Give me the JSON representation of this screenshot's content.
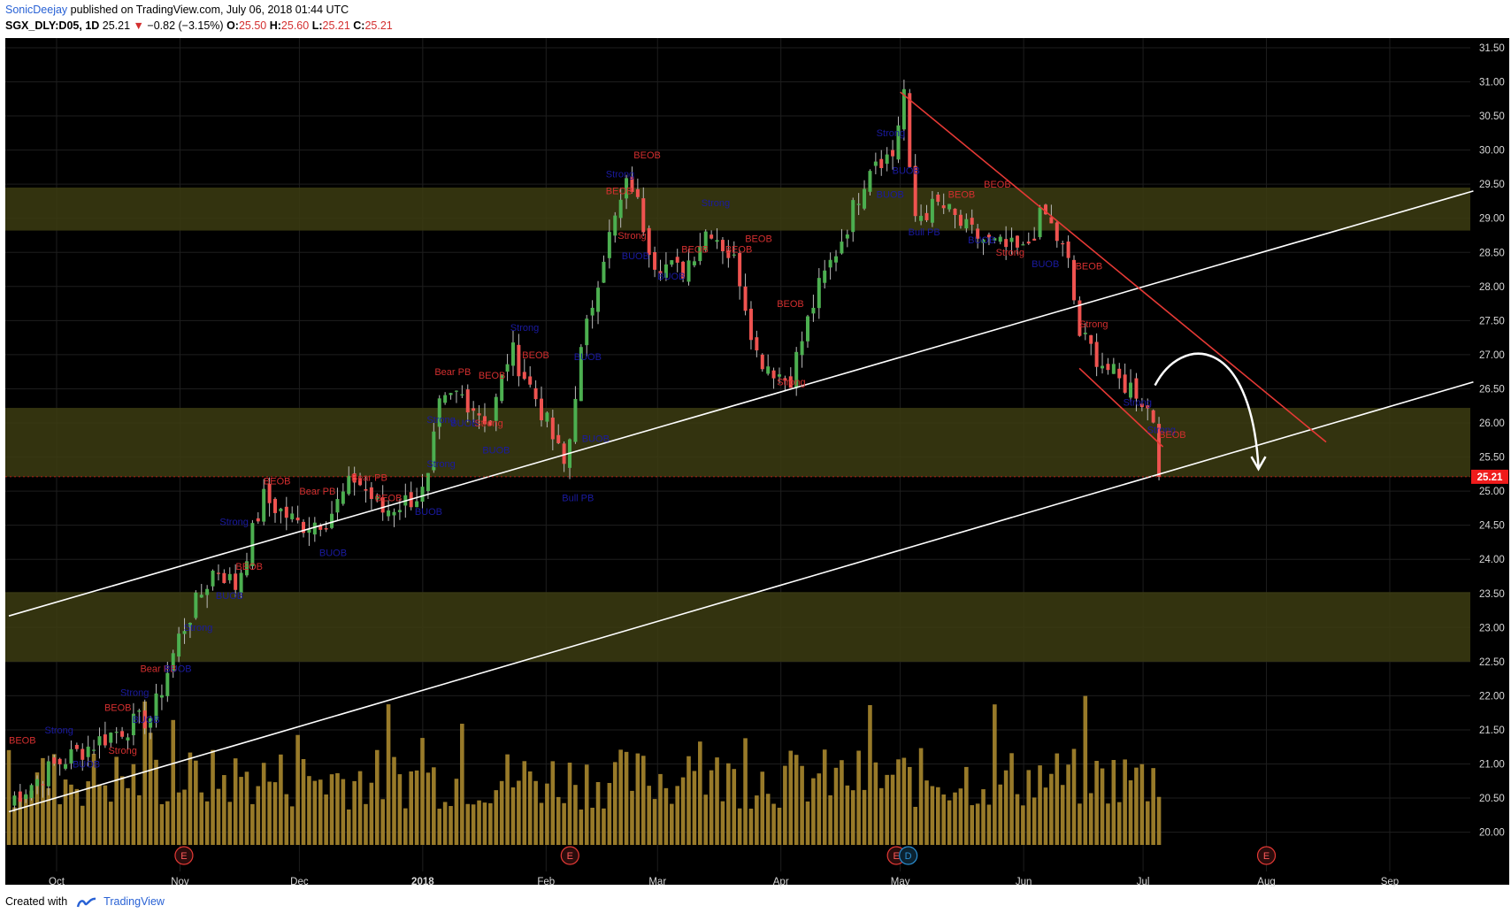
{
  "header": {
    "author": "SonicDeejay",
    "published_text": " published on TradingView.com, July 06, 2018 01:44 UTC",
    "symbol": "SGX_DLY:D05, 1D",
    "last": "25.21",
    "change": "−0.82 (−3.15%)",
    "o_label": "O:",
    "o": "25.50",
    "h_label": "H:",
    "h": "25.60",
    "l_label": "L:",
    "l": "25.21",
    "c_label": "C:",
    "c": "25.21"
  },
  "footer": {
    "created_with": "Created with",
    "brand": "TradingView"
  },
  "colors": {
    "background": "#000000",
    "up": "#4caf50",
    "down": "#ef5350",
    "zone": "#3c3c12",
    "volume": "#a8872e",
    "trendline": "#ffffff",
    "channel": "#e53935",
    "price_tag": "#ef1b1b"
  },
  "chart_data": {
    "type": "candlestick",
    "ylim": [
      19.75,
      31.95
    ],
    "y_ticks": [
      "20.00",
      "20.50",
      "21.00",
      "21.50",
      "22.00",
      "22.50",
      "23.00",
      "23.50",
      "24.00",
      "24.50",
      "25.00",
      "25.50",
      "26.00",
      "26.50",
      "27.00",
      "27.50",
      "28.00",
      "28.50",
      "29.00",
      "29.50",
      "30.00",
      "30.50",
      "31.00",
      "31.50"
    ],
    "x_ticks": [
      {
        "label": "Oct",
        "date": "2017-10-01"
      },
      {
        "label": "Nov",
        "date": "2017-11-01"
      },
      {
        "label": "Dec",
        "date": "2017-12-01"
      },
      {
        "label": "2018",
        "date": "2018-01-01"
      },
      {
        "label": "Feb",
        "date": "2018-02-01"
      },
      {
        "label": "Mar",
        "date": "2018-03-01"
      },
      {
        "label": "Apr",
        "date": "2018-04-01"
      },
      {
        "label": "May",
        "date": "2018-05-01"
      },
      {
        "label": "Jun",
        "date": "2018-06-01"
      },
      {
        "label": "Jul",
        "date": "2018-07-01"
      },
      {
        "label": "Aug",
        "date": "2018-08-01"
      },
      {
        "label": "Sep",
        "date": "2018-09-01"
      }
    ],
    "last_price_label": "25.21",
    "zones": [
      [
        28.82,
        29.45
      ],
      [
        25.21,
        26.22
      ],
      [
        22.5,
        23.52
      ]
    ],
    "trendlines": [
      {
        "from": [
          "2017-09-19",
          23.17
        ],
        "to": [
          "2018-09-22",
          29.4
        ]
      },
      {
        "from": [
          "2017-09-19",
          20.3
        ],
        "to": [
          "2018-09-22",
          26.6
        ]
      },
      {
        "from": [
          "2018-05-01",
          30.85
        ],
        "to": [
          "2018-08-16",
          25.72
        ]
      },
      {
        "from": [
          "2018-06-15",
          26.8
        ],
        "to": [
          "2018-07-06",
          25.65
        ]
      }
    ],
    "earnings_markers": [
      {
        "label": "E",
        "date": "2017-11-02"
      },
      {
        "label": "E",
        "date": "2018-02-07"
      },
      {
        "label": "E",
        "date": "2018-04-30"
      },
      {
        "label": "D",
        "date": "2018-05-03"
      },
      {
        "label": "E",
        "date": "2018-08-01"
      }
    ],
    "ohlc_keypoints": [
      [
        "2017-09-19",
        20.45
      ],
      [
        "2017-10-01",
        21.0
      ],
      [
        "2017-10-15",
        21.45
      ],
      [
        "2017-10-25",
        21.7
      ],
      [
        "2017-11-01",
        22.9
      ],
      [
        "2017-11-10",
        23.9
      ],
      [
        "2017-11-15",
        23.6
      ],
      [
        "2017-11-22",
        24.9
      ],
      [
        "2017-12-01",
        24.5
      ],
      [
        "2017-12-08",
        24.6
      ],
      [
        "2017-12-15",
        25.2
      ],
      [
        "2017-12-22",
        24.7
      ],
      [
        "2018-01-02",
        25.0
      ],
      [
        "2018-01-05",
        26.2
      ],
      [
        "2018-01-10",
        26.45
      ],
      [
        "2018-01-18",
        26.0
      ],
      [
        "2018-01-23",
        27.1
      ],
      [
        "2018-01-30",
        26.3
      ],
      [
        "2018-02-06",
        25.3
      ],
      [
        "2018-02-09",
        26.8
      ],
      [
        "2018-02-15",
        28.4
      ],
      [
        "2018-02-22",
        29.6
      ],
      [
        "2018-02-28",
        28.4
      ],
      [
        "2018-03-07",
        28.2
      ],
      [
        "2018-03-14",
        28.9
      ],
      [
        "2018-03-21",
        28.3
      ],
      [
        "2018-03-26",
        27.0
      ],
      [
        "2018-04-03",
        26.6
      ],
      [
        "2018-04-10",
        27.9
      ],
      [
        "2018-04-17",
        28.8
      ],
      [
        "2018-04-24",
        29.9
      ],
      [
        "2018-04-29",
        29.9
      ],
      [
        "2018-05-02",
        30.9
      ],
      [
        "2018-05-04",
        29.0
      ],
      [
        "2018-05-11",
        29.2
      ],
      [
        "2018-05-18",
        28.8
      ],
      [
        "2018-05-25",
        28.6
      ],
      [
        "2018-06-01",
        28.5
      ],
      [
        "2018-06-06",
        29.1
      ],
      [
        "2018-06-12",
        28.4
      ],
      [
        "2018-06-15",
        27.3
      ],
      [
        "2018-06-19",
        27.0
      ],
      [
        "2018-06-25",
        26.6
      ],
      [
        "2018-06-29",
        26.5
      ],
      [
        "2018-07-04",
        26.03
      ],
      [
        "2018-07-05",
        25.21
      ]
    ]
  },
  "signals": [
    {
      "t": "BEOB",
      "date": "2017-09-19",
      "p": 21.3,
      "c": "#d32f2f"
    },
    {
      "t": "Strong",
      "date": "2017-09-28",
      "p": 21.45,
      "c": "#1a1aa0"
    },
    {
      "t": "BUOB",
      "date": "2017-10-05",
      "p": 20.95,
      "c": "#1a1aa0"
    },
    {
      "t": "BEOB",
      "date": "2017-10-13",
      "p": 21.78,
      "c": "#d32f2f"
    },
    {
      "t": "Strong",
      "date": "2017-10-14",
      "p": 21.15,
      "c": "#d32f2f"
    },
    {
      "t": "Strong",
      "date": "2017-10-17",
      "p": 22.0,
      "c": "#1a1aa0"
    },
    {
      "t": "BUOB",
      "date": "2017-10-20",
      "p": 21.6,
      "c": "#1a1aa0"
    },
    {
      "t": "Bear PB",
      "date": "2017-10-22",
      "p": 22.35,
      "c": "#d32f2f"
    },
    {
      "t": "BUOB",
      "date": "2017-10-28",
      "p": 22.35,
      "c": "#1a1aa0"
    },
    {
      "t": "Strong",
      "date": "2017-11-02",
      "p": 22.95,
      "c": "#1a1aa0"
    },
    {
      "t": "BUOB",
      "date": "2017-11-10",
      "p": 23.42,
      "c": "#1a1aa0"
    },
    {
      "t": "Strong",
      "date": "2017-11-11",
      "p": 24.5,
      "c": "#1a1aa0"
    },
    {
      "t": "BEOB",
      "date": "2017-11-15",
      "p": 23.85,
      "c": "#d32f2f"
    },
    {
      "t": "BEOB",
      "date": "2017-11-22",
      "p": 25.1,
      "c": "#d32f2f"
    },
    {
      "t": "Bear PB",
      "date": "2017-12-01",
      "p": 24.95,
      "c": "#d32f2f"
    },
    {
      "t": "BUOB",
      "date": "2017-12-06",
      "p": 24.05,
      "c": "#1a1aa0"
    },
    {
      "t": "Bear PB",
      "date": "2017-12-14",
      "p": 25.15,
      "c": "#d32f2f"
    },
    {
      "t": "BEOB",
      "date": "2017-12-20",
      "p": 24.85,
      "c": "#d32f2f"
    },
    {
      "t": "BUOB",
      "date": "2017-12-30",
      "p": 24.65,
      "c": "#1a1aa0"
    },
    {
      "t": "Strong",
      "date": "2018-01-02",
      "p": 25.35,
      "c": "#1a1aa0"
    },
    {
      "t": "Strong",
      "date": "2018-01-02",
      "p": 26.0,
      "c": "#1a1aa0"
    },
    {
      "t": "Bear PB",
      "date": "2018-01-04",
      "p": 26.7,
      "c": "#d32f2f"
    },
    {
      "t": "BUOB",
      "date": "2018-01-08",
      "p": 25.95,
      "c": "#1a1aa0"
    },
    {
      "t": "BEOB",
      "date": "2018-01-15",
      "p": 26.65,
      "c": "#d32f2f"
    },
    {
      "t": "Strong",
      "date": "2018-01-14",
      "p": 25.95,
      "c": "#d32f2f"
    },
    {
      "t": "BUOB",
      "date": "2018-01-16",
      "p": 25.55,
      "c": "#1a1aa0"
    },
    {
      "t": "Strong",
      "date": "2018-01-23",
      "p": 27.35,
      "c": "#1a1aa0"
    },
    {
      "t": "BEOB",
      "date": "2018-01-26",
      "p": 26.95,
      "c": "#d32f2f"
    },
    {
      "t": "Bull PB",
      "date": "2018-02-05",
      "p": 24.85,
      "c": "#1a1aa0"
    },
    {
      "t": "BUOB",
      "date": "2018-02-08",
      "p": 26.92,
      "c": "#1a1aa0"
    },
    {
      "t": "BUOB",
      "date": "2018-02-10",
      "p": 25.72,
      "c": "#1a1aa0"
    },
    {
      "t": "Strong",
      "date": "2018-02-16",
      "p": 29.6,
      "c": "#1a1aa0"
    },
    {
      "t": "BEOB",
      "date": "2018-02-16",
      "p": 29.35,
      "c": "#d32f2f"
    },
    {
      "t": "BEOB",
      "date": "2018-02-23",
      "p": 29.88,
      "c": "#d32f2f"
    },
    {
      "t": "Strong",
      "date": "2018-02-19",
      "p": 28.7,
      "c": "#d32f2f"
    },
    {
      "t": "BUOB",
      "date": "2018-02-20",
      "p": 28.4,
      "c": "#1a1aa0"
    },
    {
      "t": "BUOB",
      "date": "2018-03-01",
      "p": 28.1,
      "c": "#1a1aa0"
    },
    {
      "t": "BEOB",
      "date": "2018-03-07",
      "p": 28.5,
      "c": "#d32f2f"
    },
    {
      "t": "Strong",
      "date": "2018-03-12",
      "p": 29.18,
      "c": "#1a1aa0"
    },
    {
      "t": "BEOB",
      "date": "2018-03-18",
      "p": 28.5,
      "c": "#d32f2f"
    },
    {
      "t": "BEOB",
      "date": "2018-03-23",
      "p": 28.65,
      "c": "#d32f2f"
    },
    {
      "t": "BEOB",
      "date": "2018-03-31",
      "p": 27.7,
      "c": "#d32f2f"
    },
    {
      "t": "Strong",
      "date": "2018-03-31",
      "p": 26.55,
      "c": "#d32f2f"
    },
    {
      "t": "Strong",
      "date": "2018-04-25",
      "p": 30.2,
      "c": "#1a1aa0"
    },
    {
      "t": "BUOB",
      "date": "2018-04-29",
      "p": 29.65,
      "c": "#1a1aa0"
    },
    {
      "t": "BUOB",
      "date": "2018-04-25",
      "p": 29.3,
      "c": "#1a1aa0"
    },
    {
      "t": "Bull PB",
      "date": "2018-05-03",
      "p": 28.75,
      "c": "#1a1aa0"
    },
    {
      "t": "BEOB",
      "date": "2018-05-13",
      "p": 29.3,
      "c": "#d32f2f"
    },
    {
      "t": "BEOB",
      "date": "2018-05-22",
      "p": 29.45,
      "c": "#d32f2f"
    },
    {
      "t": "BUOB",
      "date": "2018-05-18",
      "p": 28.63,
      "c": "#1a1aa0"
    },
    {
      "t": "Strong",
      "date": "2018-05-25",
      "p": 28.45,
      "c": "#d32f2f"
    },
    {
      "t": "BUOB",
      "date": "2018-06-03",
      "p": 28.28,
      "c": "#1a1aa0"
    },
    {
      "t": "BEOB",
      "date": "2018-06-14",
      "p": 28.25,
      "c": "#d32f2f"
    },
    {
      "t": "Strong",
      "date": "2018-06-15",
      "p": 27.4,
      "c": "#d32f2f"
    },
    {
      "t": "Strong",
      "date": "2018-06-26",
      "p": 26.25,
      "c": "#1a1aa0"
    },
    {
      "t": "Strong",
      "date": "2018-07-02",
      "p": 25.85,
      "c": "#1a1aa0"
    },
    {
      "t": "BEOB",
      "date": "2018-07-05",
      "p": 25.78,
      "c": "#d32f2f"
    }
  ]
}
